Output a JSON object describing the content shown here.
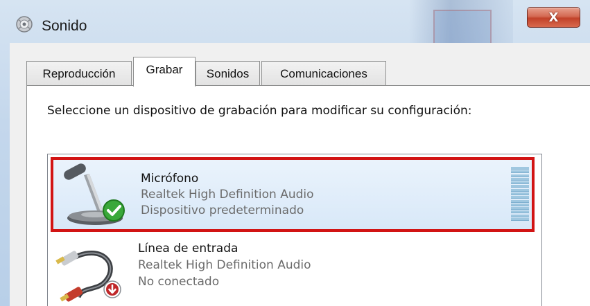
{
  "window": {
    "title": "Sonido",
    "close_label": "X"
  },
  "tabs": [
    {
      "label": "Reproducción",
      "active": false
    },
    {
      "label": "Grabar",
      "active": true
    },
    {
      "label": "Sonidos",
      "active": false
    },
    {
      "label": "Comunicaciones",
      "active": false
    }
  ],
  "panel": {
    "instructions": "Seleccione un dispositivo de grabación para modificar su configuración:"
  },
  "devices": [
    {
      "name": "Micrófono",
      "driver": "Realtek High Definition Audio",
      "status": "Dispositivo predeterminado",
      "icon": "microphone-icon",
      "badge": "default-check-icon",
      "selected": true
    },
    {
      "name": "Línea de entrada",
      "driver": "Realtek High Definition Audio",
      "status": "No conectado",
      "icon": "line-in-cable-icon",
      "badge": "disconnected-arrow-icon",
      "selected": false
    }
  ],
  "colors": {
    "selection_outline": "#d21414",
    "close_button": "#c2422a",
    "level_meter": "#9fc7e0"
  }
}
